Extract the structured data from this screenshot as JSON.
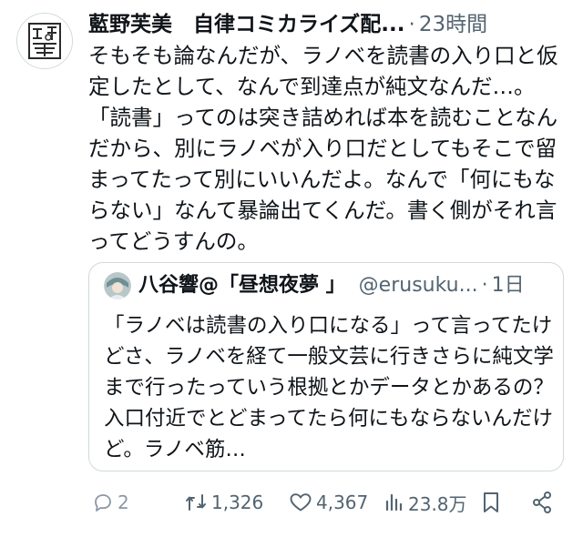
{
  "author": {
    "name": "藍野芙美　自律コミカライズ配...",
    "separator": "·",
    "time": "23時間"
  },
  "tweet_text": "そもそも論なんだが、ラノベを読書の入り口と仮定したとして、なんで到達点が純文なんだ…。「読書」ってのは突き詰めれば本を読むことなんだから、別にラノベが入り口だとしてもそこで留まってたって別にいいんだよ。なんで「何にもならない」なんて暴論出てくんだ。書く側がそれ言ってどうすんの。",
  "quote": {
    "name": "八谷響@「昼想夜夢 」",
    "handle": "@erusuku...",
    "separator": "·",
    "time": "1日",
    "text": "「ラノベは読書の入り口になる」って言ってたけどさ、ラノベを経て一般文芸に行きさらに純文学まで行ったっていう根拠とかデータとかあるの？ 入口付近でとどまってたら何にもならないんだけど。ラノベ筋…"
  },
  "actions": {
    "reply_count": "2",
    "retweet_count": "1,326",
    "like_count": "4,367",
    "view_count": "23.8万"
  },
  "icons": [
    "reply-icon",
    "retweet-icon",
    "like-icon",
    "views-icon",
    "bookmark-icon",
    "share-icon"
  ],
  "colors": {
    "text": "#0f1419",
    "muted": "#536471",
    "border": "#cfd9de"
  }
}
